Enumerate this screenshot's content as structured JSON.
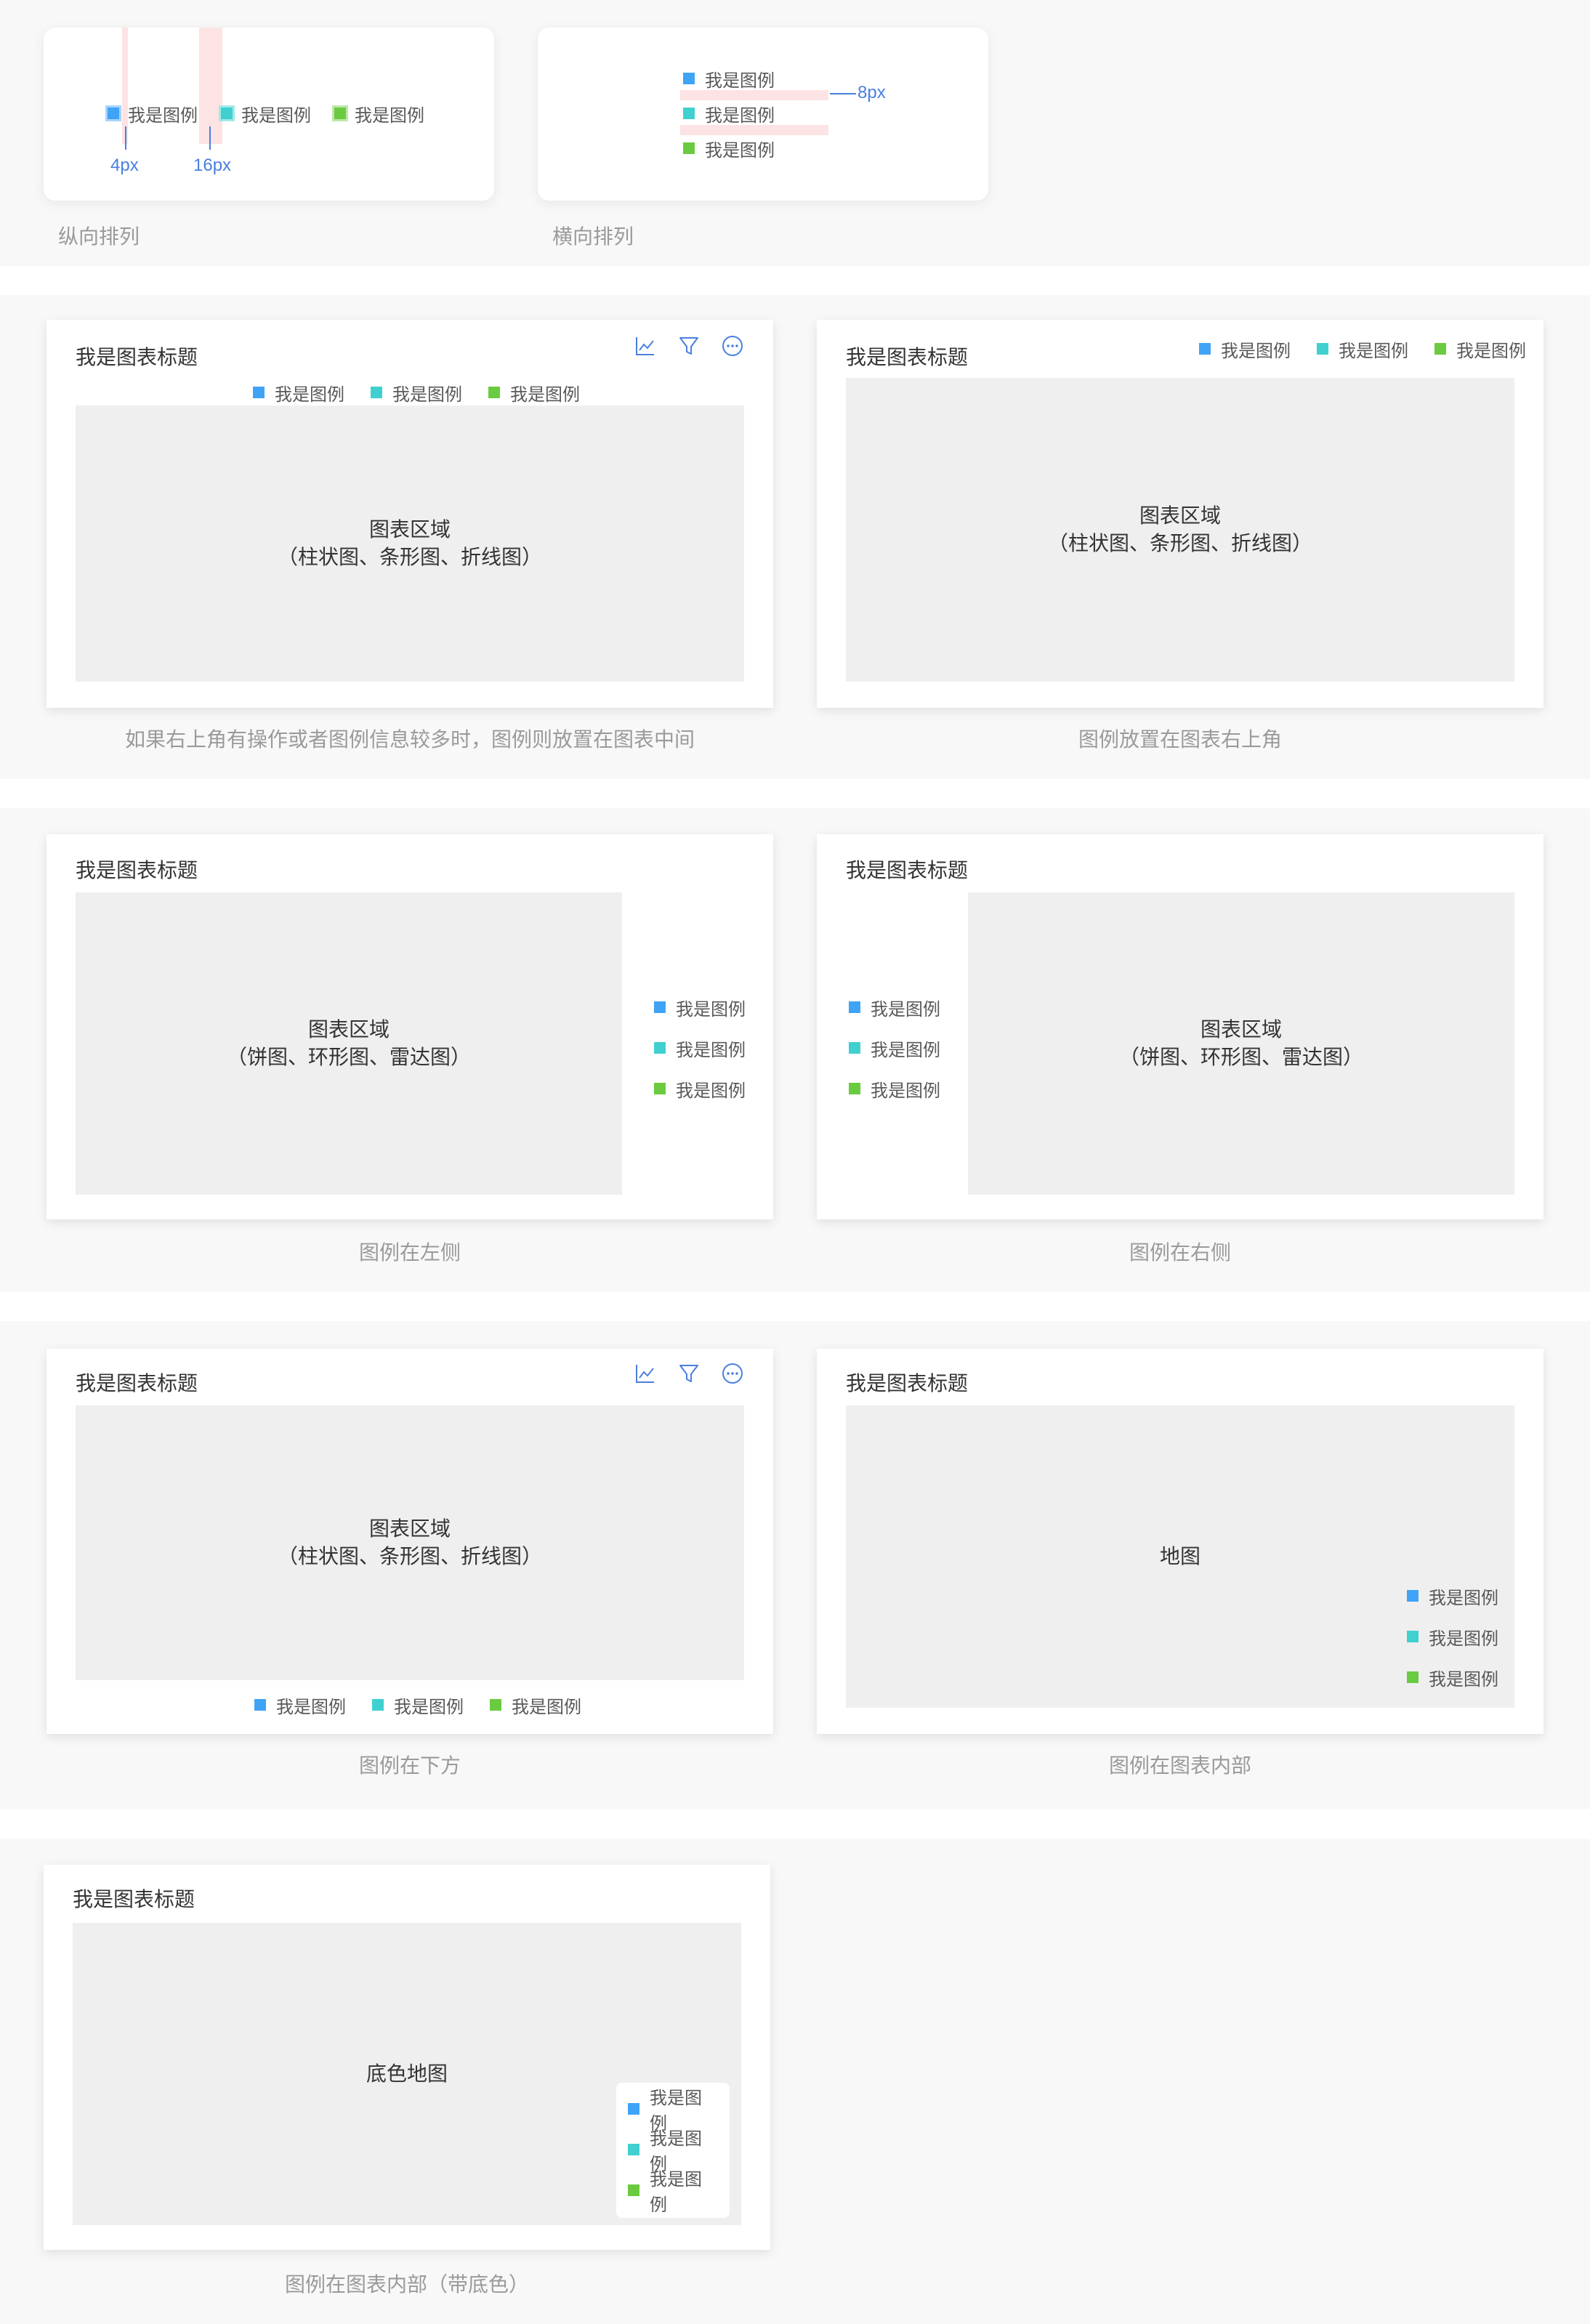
{
  "colors": {
    "blue": "#3fa3f6",
    "cyan": "#40d0d0",
    "green": "#6acb40",
    "area": "#efefef",
    "measure": "#4a7fe0",
    "spacing": "#fde3e3"
  },
  "legend_label": "我是图例",
  "chart_title": "我是图表标题",
  "area_title": "图表区域",
  "bar_types": "（柱状图、条形图、折线图）",
  "pie_types": "（饼图、环形图、雷达图）",
  "map_text": "地图",
  "base_map_text": "底色地图",
  "spacing": {
    "small_gap": "4px",
    "item_gap": "16px",
    "row_gap": "8px",
    "caption_vertical": "纵向排列",
    "caption_horizontal": "横向排列"
  },
  "captions": {
    "top_center": "如果右上角有操作或者图例信息较多时，图例则放置在图表中间",
    "top_right": "图例放置在图表右上角",
    "left": "图例在左侧",
    "right": "图例在右侧",
    "bottom": "图例在下方",
    "inside": "图例在图表内部",
    "inside_bg": "图例在图表内部（带底色）"
  },
  "icons": [
    "line-chart-icon",
    "filter-icon",
    "more-icon"
  ]
}
